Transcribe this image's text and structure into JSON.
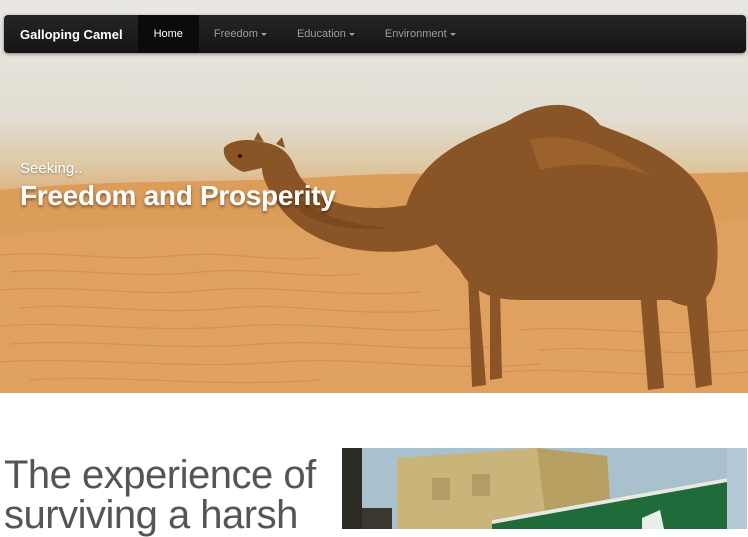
{
  "navbar": {
    "brand": "Galloping Camel",
    "items": [
      {
        "label": "Home",
        "active": true,
        "dropdown": false
      },
      {
        "label": "Freedom",
        "active": false,
        "dropdown": true
      },
      {
        "label": "Education",
        "active": false,
        "dropdown": true
      },
      {
        "label": "Environment",
        "active": false,
        "dropdown": true
      }
    ]
  },
  "hero": {
    "kicker": "Seeking..",
    "title": "Freedom and Prosperity"
  },
  "feature": {
    "heading": "The experience of surviving a harsh"
  },
  "colors": {
    "navbar_bg": "#1b1b1b",
    "nav_active_bg": "#0b0b0b",
    "nav_text": "#9d9d9d",
    "heading_text": "#555555",
    "sand": "#e3a25c"
  }
}
